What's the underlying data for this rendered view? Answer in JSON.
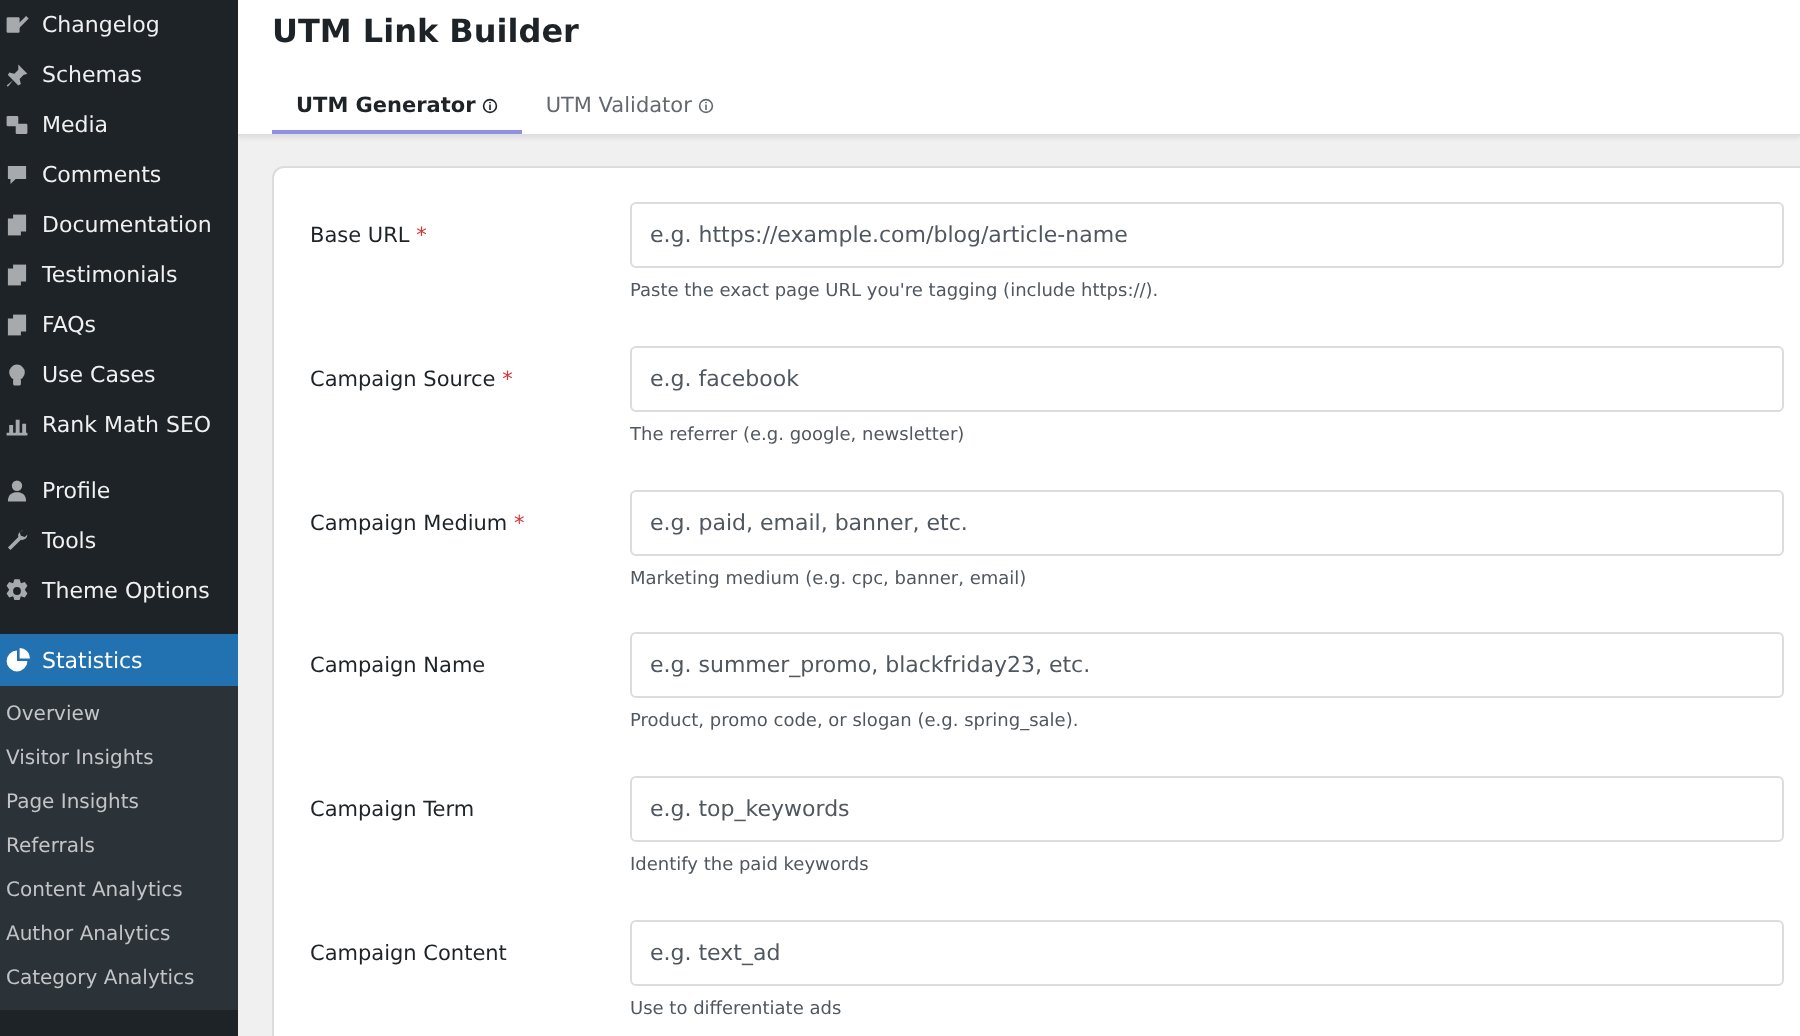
{
  "sidebar": {
    "groups": [
      {
        "items": [
          {
            "label": "Changelog",
            "selected": false
          },
          {
            "label": "Schemas",
            "selected": false
          },
          {
            "label": "Media",
            "selected": false
          },
          {
            "label": "Comments",
            "selected": false
          },
          {
            "label": "Documentation",
            "selected": false
          },
          {
            "label": "Testimonials",
            "selected": false
          },
          {
            "label": "FAQs",
            "selected": false
          },
          {
            "label": "Use Cases",
            "selected": false
          },
          {
            "label": "Rank Math SEO",
            "selected": false
          }
        ]
      },
      {
        "items": [
          {
            "label": "Profile",
            "selected": false
          },
          {
            "label": "Tools",
            "selected": false
          },
          {
            "label": "Theme Options",
            "selected": false
          },
          {
            "label": "Statistics",
            "selected": true,
            "children": [
              {
                "label": "Overview"
              },
              {
                "label": "Visitor Insights"
              },
              {
                "label": "Page Insights"
              },
              {
                "label": "Referrals"
              },
              {
                "label": "Content Analytics"
              },
              {
                "label": "Author Analytics"
              },
              {
                "label": "Category Analytics"
              }
            ]
          }
        ]
      }
    ]
  },
  "page": {
    "title": "UTM Link Builder"
  },
  "tabs": [
    {
      "label": "UTM Generator",
      "selected": true
    },
    {
      "label": "UTM Validator",
      "selected": false
    }
  ],
  "form": {
    "fields": [
      {
        "label": "Base URL",
        "required_mark": "*",
        "placeholder": "e.g. https://example.com/blog/article-name",
        "hint": "Paste the exact page URL you're tagging (include https://)."
      },
      {
        "label": "Campaign Source",
        "required_mark": "*",
        "placeholder": "e.g. facebook",
        "hint": "The referrer (e.g. google, newsletter)"
      },
      {
        "label": "Campaign Medium",
        "required_mark": "*",
        "placeholder": "e.g. paid, email, banner, etc.",
        "hint": "Marketing medium (e.g. cpc, banner, email)"
      },
      {
        "label": "Campaign Name",
        "placeholder": "e.g. summer_promo, blackfriday23, etc.",
        "hint": "Product, promo code, or slogan (e.g. spring_sale)."
      },
      {
        "label": "Campaign Term",
        "placeholder": "e.g. top_keywords",
        "hint": "Identify the paid keywords"
      },
      {
        "label": "Campaign Content",
        "placeholder": "e.g. text_ad",
        "hint": "Use to differentiate ads"
      }
    ]
  }
}
